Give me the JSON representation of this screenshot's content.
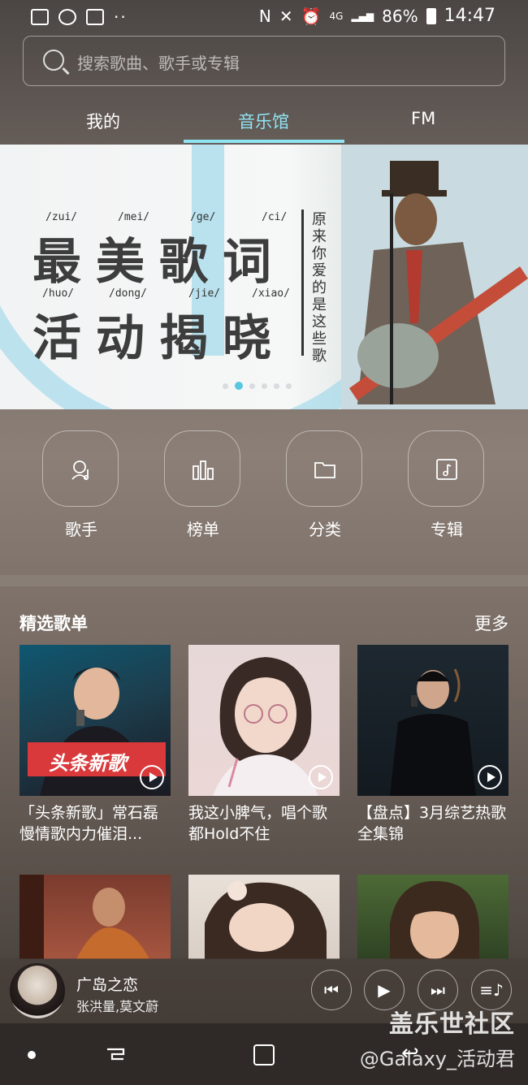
{
  "status_bar": {
    "battery": "86%",
    "time": "14:47",
    "network": "4G"
  },
  "search": {
    "placeholder": "搜索歌曲、歌手或专辑"
  },
  "tabs": [
    {
      "label": "我的"
    },
    {
      "label": "音乐馆"
    },
    {
      "label": "FM"
    }
  ],
  "banner": {
    "pinyin_row1": [
      "/zui/",
      "/mei/",
      "/ge/",
      "/ci/"
    ],
    "title_row1": "最美歌词",
    "pinyin_row2": [
      "/huo/",
      "/dong/",
      "/jie/",
      "/xiao/"
    ],
    "title_row2": "活动揭晓",
    "vertical_text": "原来你爱的是这些歌",
    "dots_count": 6,
    "active_dot": 1
  },
  "categories": [
    {
      "label": "歌手",
      "icon": "singer-icon"
    },
    {
      "label": "榜单",
      "icon": "chart-icon"
    },
    {
      "label": "分类",
      "icon": "folder-icon"
    },
    {
      "label": "专辑",
      "icon": "album-icon"
    }
  ],
  "featured": {
    "title": "精选歌单",
    "more": "更多",
    "cards": [
      {
        "title": "「头条新歌」常石磊慢情歌内力催泪...",
        "badge": "头条新歌"
      },
      {
        "title": "我这小脾气，唱个歌都Hold不住"
      },
      {
        "title": "【盘点】3月综艺热歌全集锦"
      }
    ]
  },
  "player": {
    "song": "广岛之恋",
    "artist": "张洪量,莫文蔚"
  },
  "watermark": {
    "line1": "盖乐世社区",
    "line2": "@Galaxy_活动君"
  },
  "colors": {
    "accent": "#8fe4f2"
  }
}
